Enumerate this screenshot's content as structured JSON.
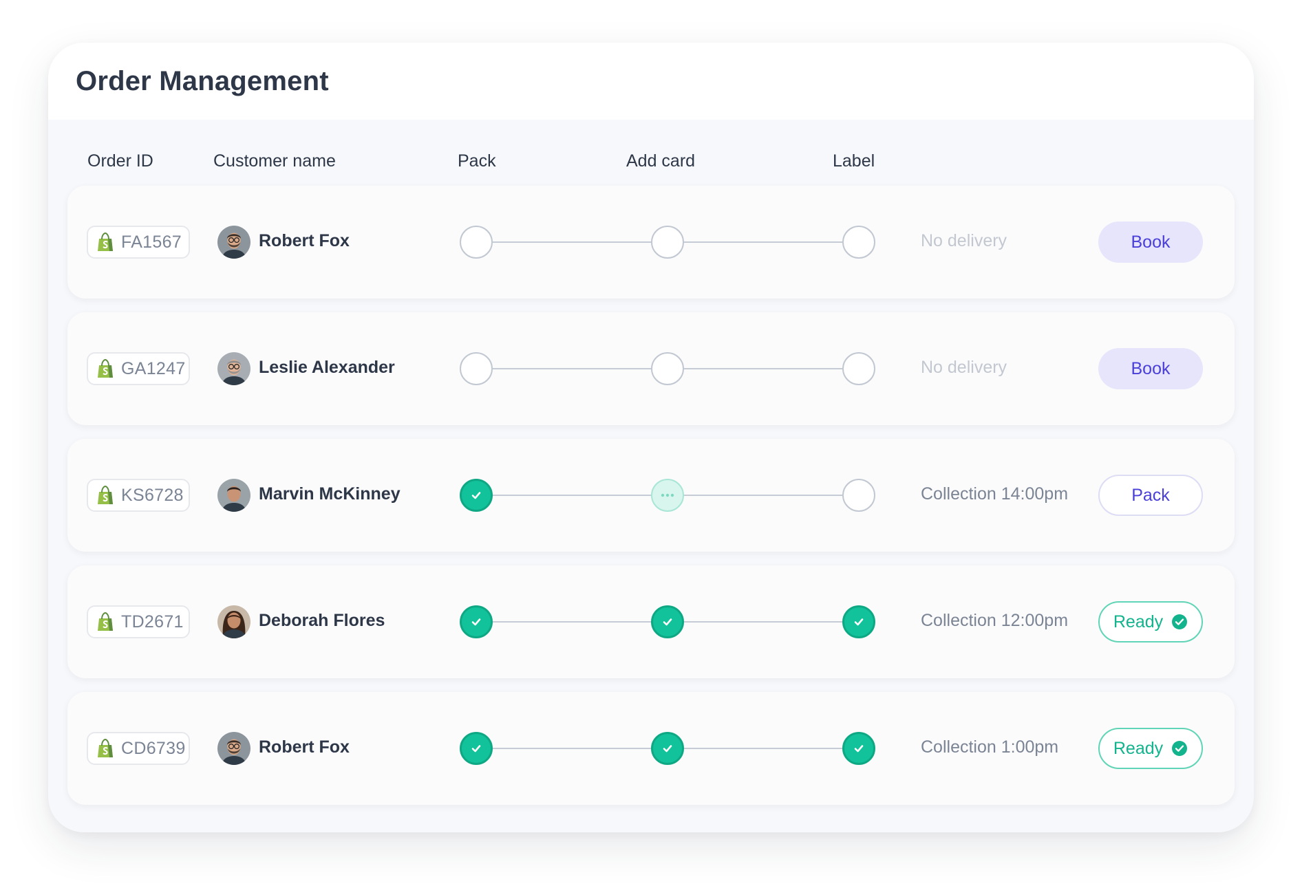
{
  "page": {
    "title": "Order Management"
  },
  "columns": {
    "order_id": "Order ID",
    "customer": "Customer name",
    "pack": "Pack",
    "add_card": "Add card",
    "label": "Label"
  },
  "colors": {
    "accent": "#4a3fd9",
    "success": "#12c29a",
    "muted": "#c2c7d0",
    "text": "#2d3748"
  },
  "orders": [
    {
      "id": "FA1567",
      "store_icon": "shopify-bag-icon",
      "customer": "Robert Fox",
      "avatar": "man-glasses-beard",
      "steps": [
        "pending",
        "pending",
        "pending"
      ],
      "status": "No delivery",
      "status_kind": "none",
      "action": "Book",
      "action_kind": "book"
    },
    {
      "id": "GA1247",
      "store_icon": "shopify-bag-icon",
      "customer": "Leslie Alexander",
      "avatar": "older-man-glasses",
      "steps": [
        "pending",
        "pending",
        "pending"
      ],
      "status": "No delivery",
      "status_kind": "none",
      "action": "Book",
      "action_kind": "book"
    },
    {
      "id": "KS6728",
      "store_icon": "shopify-bag-icon",
      "customer": "Marvin McKinney",
      "avatar": "man-dark-hair",
      "steps": [
        "done",
        "in-progress",
        "pending"
      ],
      "status": "Collection 14:00pm",
      "status_kind": "set",
      "action": "Pack",
      "action_kind": "pack"
    },
    {
      "id": "TD2671",
      "store_icon": "shopify-bag-icon",
      "customer": "Deborah Flores",
      "avatar": "woman-long-hair",
      "steps": [
        "done",
        "done",
        "done"
      ],
      "status": "Collection 12:00pm",
      "status_kind": "set",
      "action": "Ready",
      "action_kind": "ready"
    },
    {
      "id": "CD6739",
      "store_icon": "shopify-bag-icon",
      "customer": "Robert Fox",
      "avatar": "man-glasses-beard",
      "steps": [
        "done",
        "done",
        "done"
      ],
      "status": "Collection 1:00pm",
      "status_kind": "set",
      "action": "Ready",
      "action_kind": "ready"
    }
  ]
}
